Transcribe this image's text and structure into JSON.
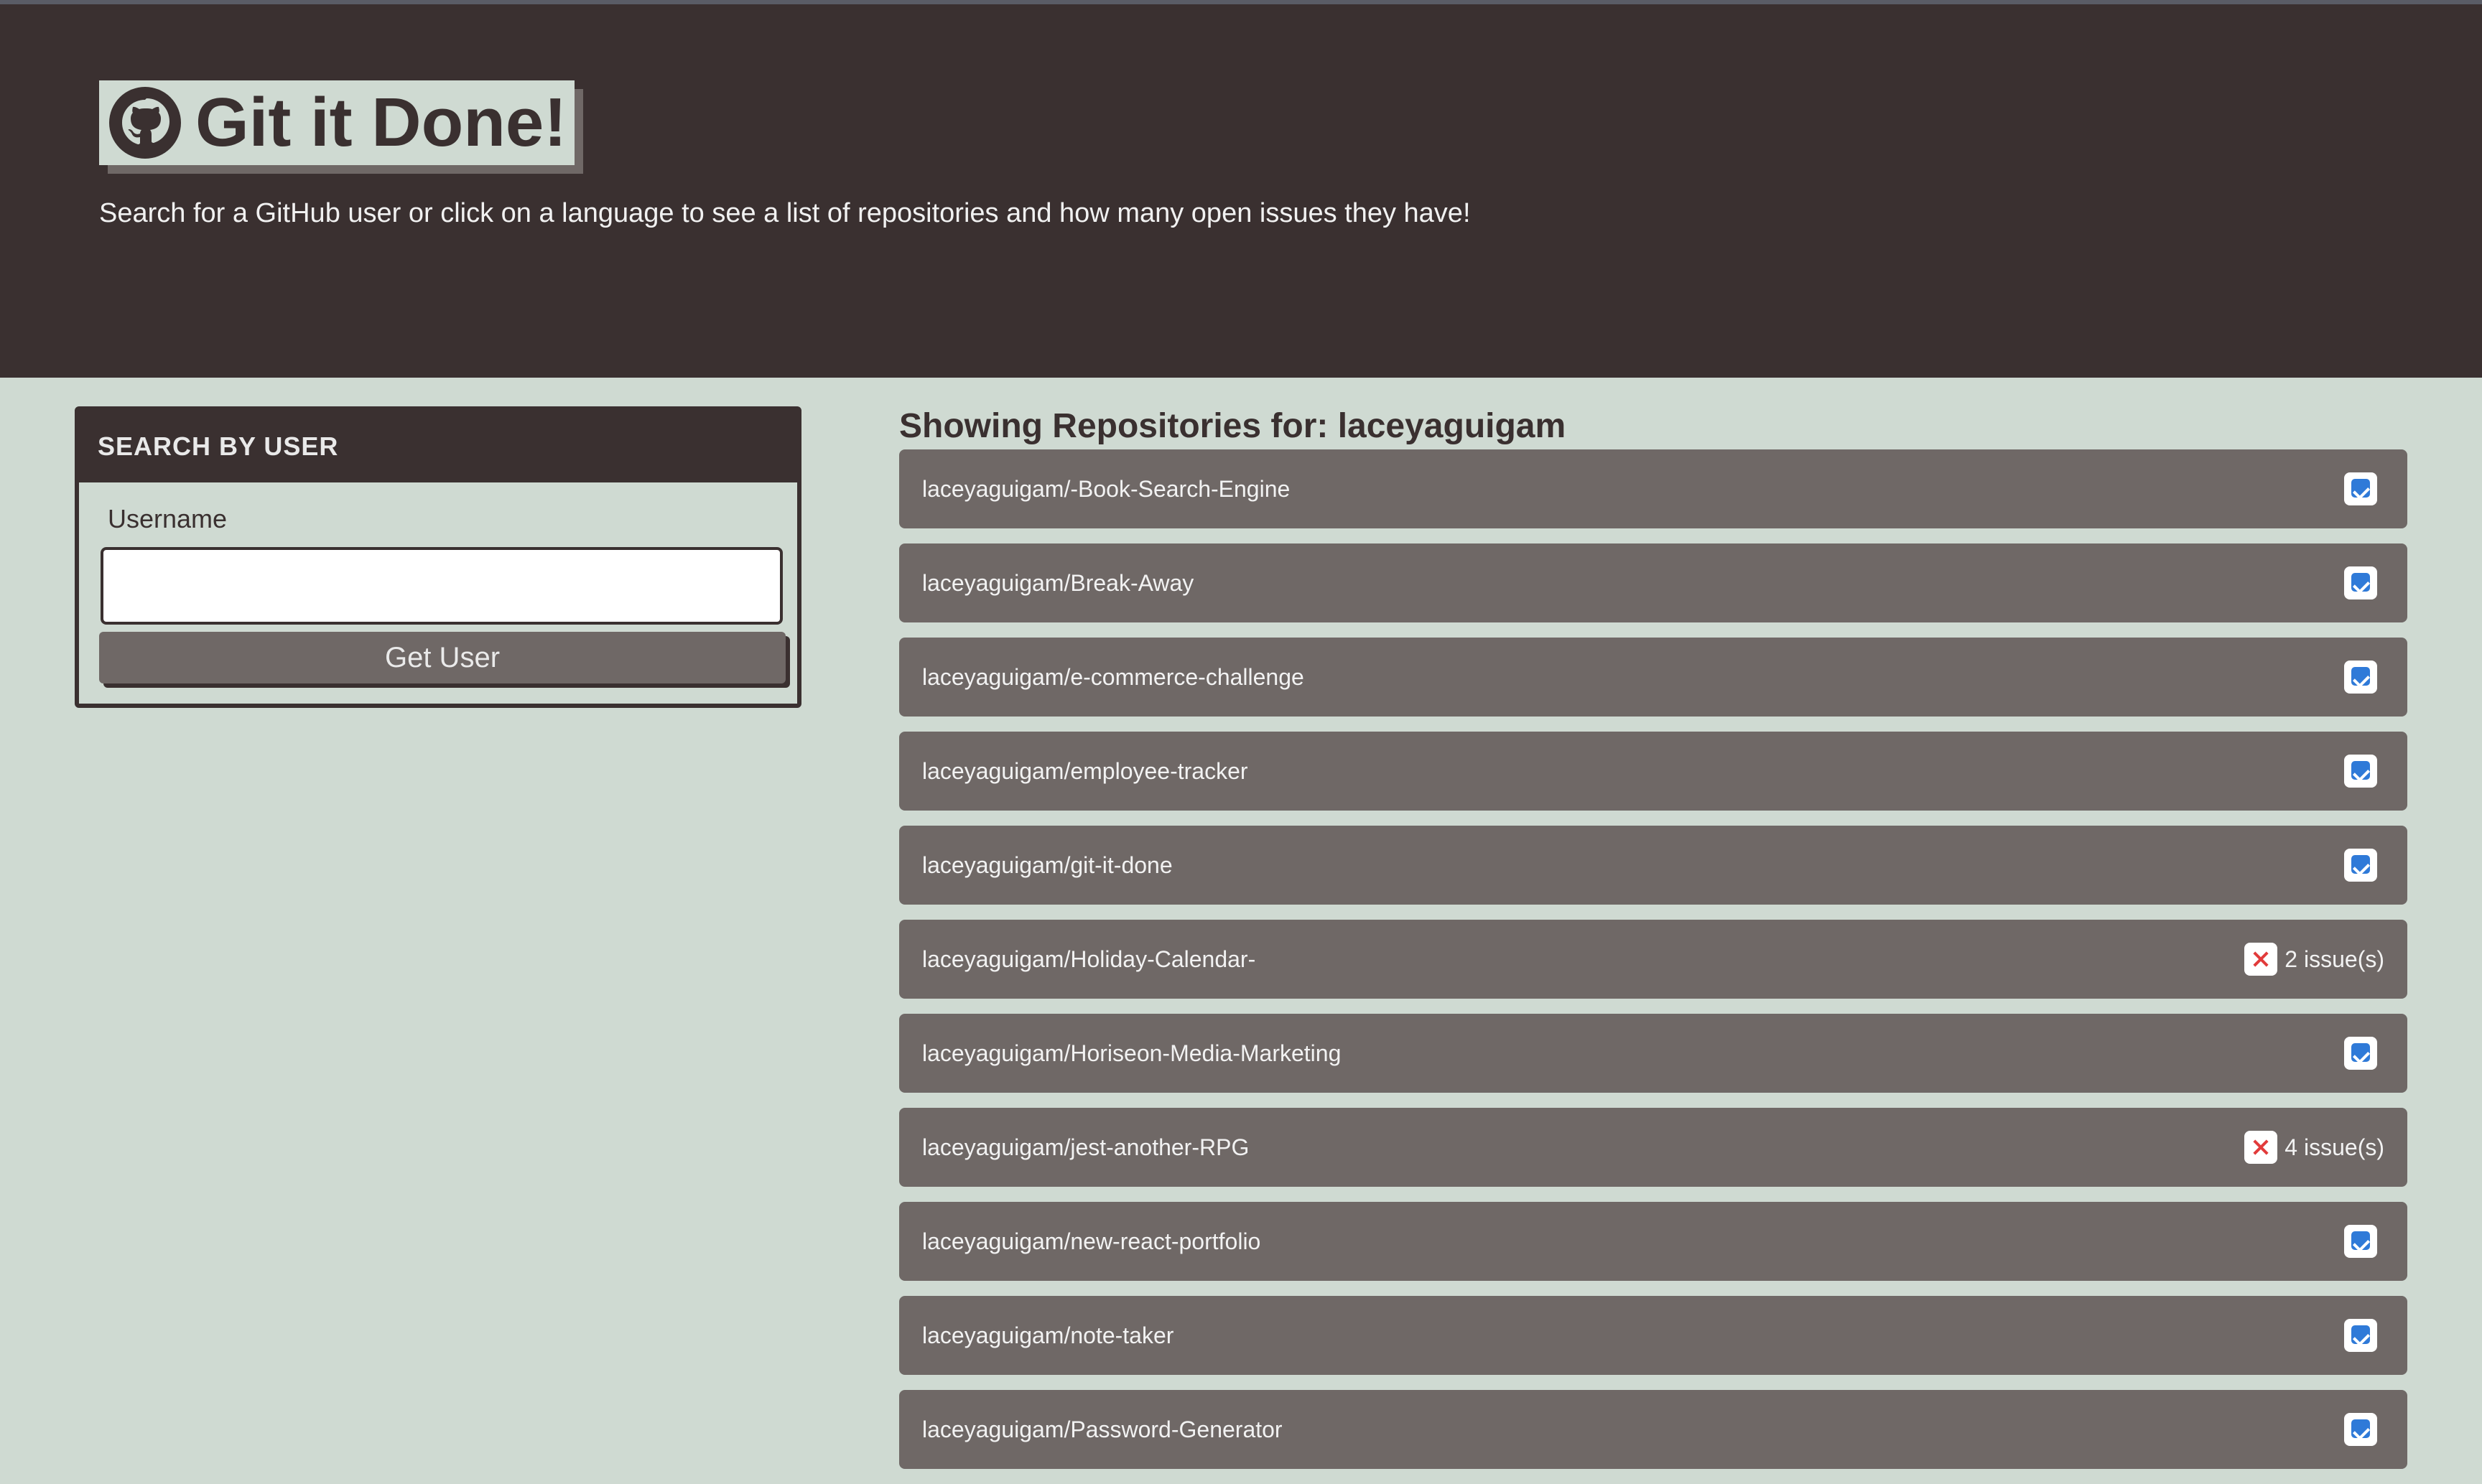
{
  "header": {
    "title": "Git it Done!",
    "subtitle": "Search for a GitHub user or click on a language to see a list of repositories and how many open issues they have!"
  },
  "search": {
    "header": "SEARCH BY USER",
    "label": "Username",
    "placeholder": "",
    "button_label": "Get User"
  },
  "repos": {
    "heading": "Showing Repositories for: laceyaguigam",
    "items": [
      {
        "name": "laceyaguigam/-Book-Search-Engine",
        "status": "ok",
        "issues": ""
      },
      {
        "name": "laceyaguigam/Break-Away",
        "status": "ok",
        "issues": ""
      },
      {
        "name": "laceyaguigam/e-commerce-challenge",
        "status": "ok",
        "issues": ""
      },
      {
        "name": "laceyaguigam/employee-tracker",
        "status": "ok",
        "issues": ""
      },
      {
        "name": "laceyaguigam/git-it-done",
        "status": "ok",
        "issues": ""
      },
      {
        "name": "laceyaguigam/Holiday-Calendar-",
        "status": "issues",
        "issues": "2 issue(s)"
      },
      {
        "name": "laceyaguigam/Horiseon-Media-Marketing",
        "status": "ok",
        "issues": ""
      },
      {
        "name": "laceyaguigam/jest-another-RPG",
        "status": "issues",
        "issues": "4 issue(s)"
      },
      {
        "name": "laceyaguigam/new-react-portfolio",
        "status": "ok",
        "issues": ""
      },
      {
        "name": "laceyaguigam/note-taker",
        "status": "ok",
        "issues": ""
      },
      {
        "name": "laceyaguigam/Password-Generator",
        "status": "ok",
        "issues": ""
      }
    ]
  },
  "icons": {
    "logo": "github-icon",
    "ok": "check-icon",
    "issues": "x-icon"
  },
  "colors": {
    "header_bg": "#3a3030",
    "page_bg": "#cfdad2",
    "repo_bg": "#6f6866",
    "check": "#2f7ad8",
    "error": "#e23b3b"
  }
}
